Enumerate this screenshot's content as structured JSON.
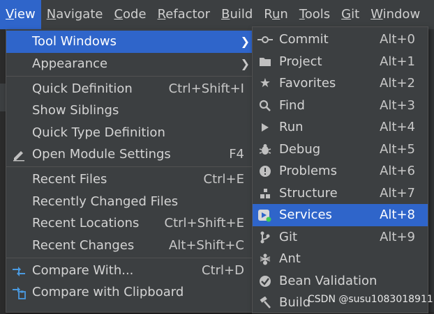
{
  "menubar": {
    "items": [
      {
        "label": "View",
        "mnemonic_index": 0
      },
      {
        "label": "Navigate",
        "mnemonic_index": 0
      },
      {
        "label": "Code",
        "mnemonic_index": 0
      },
      {
        "label": "Refactor",
        "mnemonic_index": 0
      },
      {
        "label": "Build",
        "mnemonic_index": 0
      },
      {
        "label": "Run",
        "mnemonic_index": 1
      },
      {
        "label": "Tools",
        "mnemonic_index": 0
      },
      {
        "label": "Git",
        "mnemonic_index": 0
      },
      {
        "label": "Window",
        "mnemonic_index": 0
      }
    ],
    "active": "View"
  },
  "view_menu": {
    "items": [
      {
        "label": "Tool Windows",
        "submenu": true,
        "selected": true,
        "icon": ""
      },
      {
        "label": "Appearance",
        "submenu": true,
        "icon": ""
      },
      {
        "label": "Quick Definition",
        "shortcut": "Ctrl+Shift+I",
        "icon": ""
      },
      {
        "label": "Show Siblings",
        "shortcut": "",
        "icon": ""
      },
      {
        "label": "Quick Type Definition",
        "shortcut": "",
        "icon": ""
      },
      {
        "label": "Open Module Settings",
        "shortcut": "F4",
        "icon": "edit-icon"
      },
      {
        "label": "Recent Files",
        "shortcut": "Ctrl+E",
        "icon": ""
      },
      {
        "label": "Recently Changed Files",
        "shortcut": "",
        "icon": ""
      },
      {
        "label": "Recent Locations",
        "shortcut": "Ctrl+Shift+E",
        "icon": ""
      },
      {
        "label": "Recent Changes",
        "shortcut": "Alt+Shift+C",
        "icon": ""
      },
      {
        "label": "Compare With...",
        "shortcut": "Ctrl+D",
        "icon": "compare-icon"
      },
      {
        "label": "Compare with Clipboard",
        "shortcut": "",
        "icon": "compare-clipboard-icon"
      }
    ]
  },
  "tool_windows_menu": {
    "items": [
      {
        "label": "Commit",
        "shortcut": "Alt+0",
        "icon": "commit-icon"
      },
      {
        "label": "Project",
        "shortcut": "Alt+1",
        "icon": "folder-icon"
      },
      {
        "label": "Favorites",
        "shortcut": "Alt+2",
        "icon": "star-icon"
      },
      {
        "label": "Find",
        "shortcut": "Alt+3",
        "icon": "search-icon"
      },
      {
        "label": "Run",
        "shortcut": "Alt+4",
        "icon": "play-icon"
      },
      {
        "label": "Debug",
        "shortcut": "Alt+5",
        "icon": "bug-icon"
      },
      {
        "label": "Problems",
        "shortcut": "Alt+6",
        "icon": "problems-icon"
      },
      {
        "label": "Structure",
        "shortcut": "Alt+7",
        "icon": "structure-icon"
      },
      {
        "label": "Services",
        "shortcut": "Alt+8",
        "icon": "services-icon",
        "selected": true
      },
      {
        "label": "Git",
        "shortcut": "Alt+9",
        "icon": "git-branch-icon"
      },
      {
        "label": "Ant",
        "shortcut": "",
        "icon": "ant-icon"
      },
      {
        "label": "Bean Validation",
        "shortcut": "",
        "icon": "bean-validation-icon"
      },
      {
        "label": "Build",
        "shortcut": "",
        "icon": "hammer-icon"
      }
    ]
  },
  "watermark": "CSDN @susu1083018911",
  "colors": {
    "menubar_bg": "#3c3f41",
    "menu_bg": "#3c3f41",
    "selection": "#2f65ca",
    "text": "#d4d4d4",
    "separator": "#515151"
  }
}
